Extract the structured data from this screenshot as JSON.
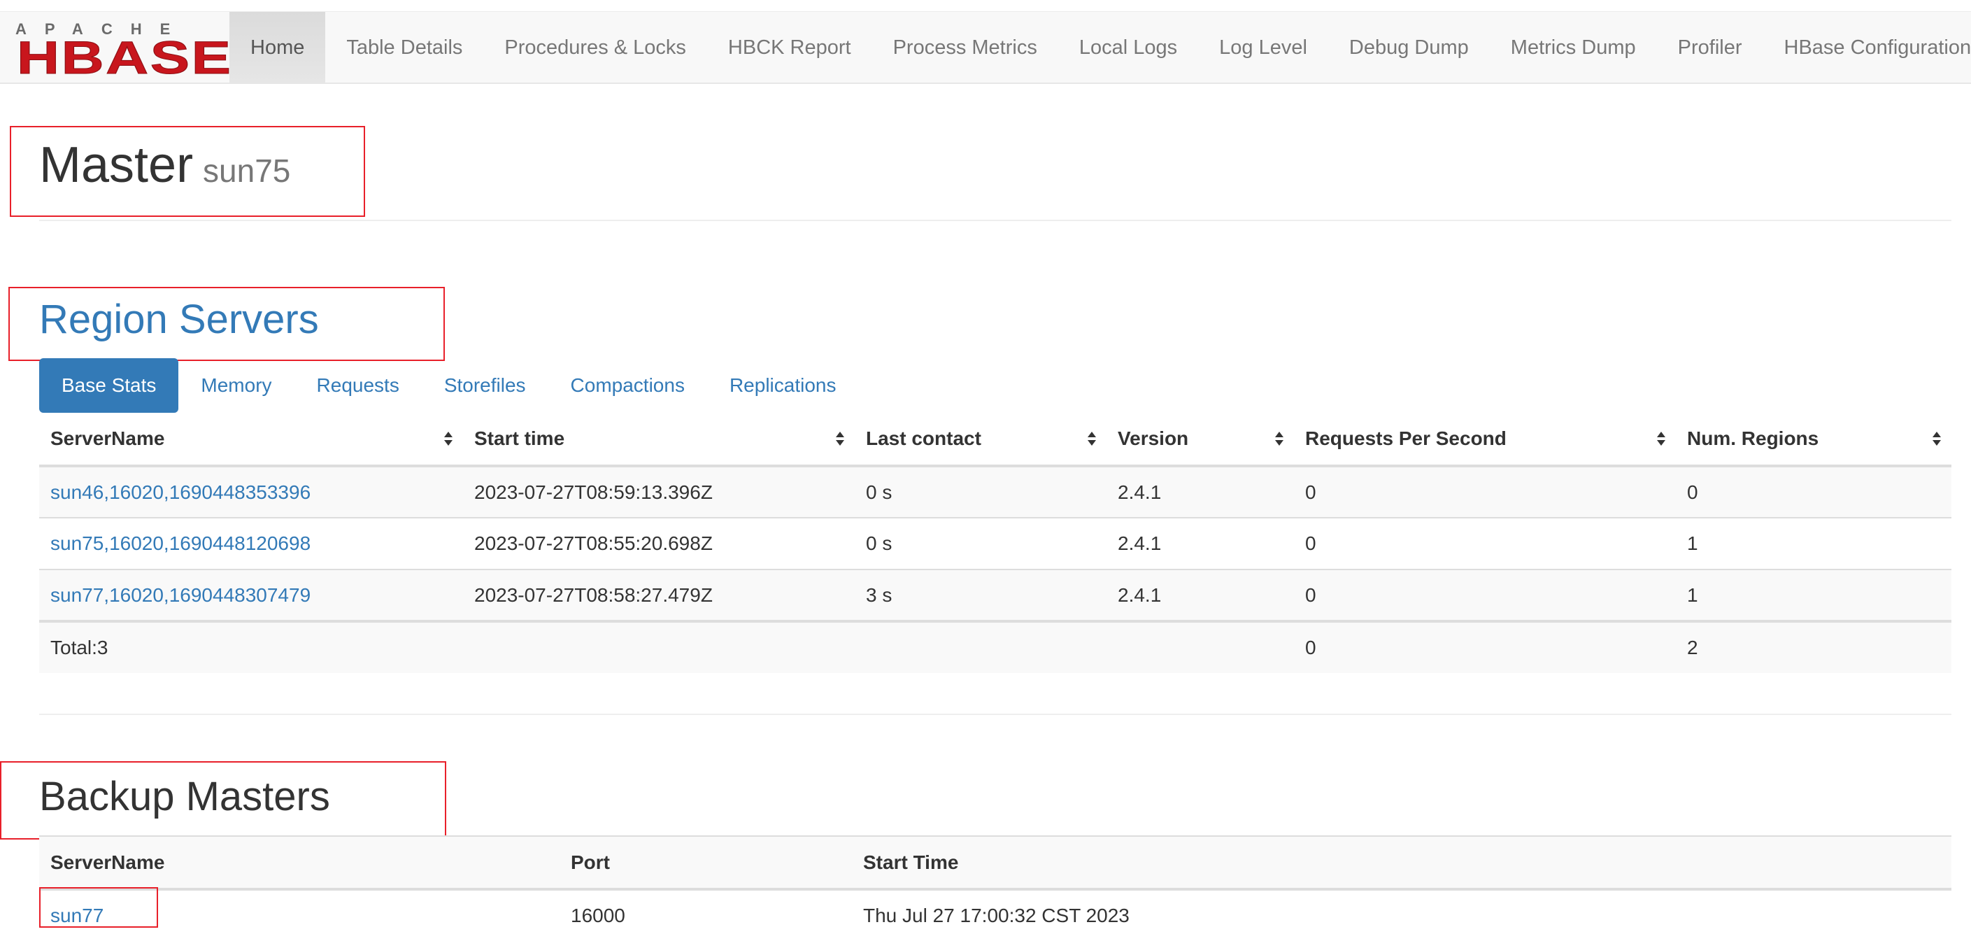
{
  "navbar": {
    "brand_top": "APACHE",
    "brand_main": "HBASE",
    "items": [
      {
        "label": "Home",
        "active": true
      },
      {
        "label": "Table Details"
      },
      {
        "label": "Procedures & Locks"
      },
      {
        "label": "HBCK Report"
      },
      {
        "label": "Process Metrics"
      },
      {
        "label": "Local Logs"
      },
      {
        "label": "Log Level"
      },
      {
        "label": "Debug Dump"
      },
      {
        "label": "Metrics Dump"
      },
      {
        "label": "Profiler"
      },
      {
        "label": "HBase Configuration"
      }
    ]
  },
  "header": {
    "title": "Master",
    "hostname": "sun75"
  },
  "region_servers": {
    "title": "Region Servers",
    "tabs": [
      {
        "label": "Base Stats",
        "active": true
      },
      {
        "label": "Memory"
      },
      {
        "label": "Requests"
      },
      {
        "label": "Storefiles"
      },
      {
        "label": "Compactions"
      },
      {
        "label": "Replications"
      }
    ],
    "columns": [
      "ServerName",
      "Start time",
      "Last contact",
      "Version",
      "Requests Per Second",
      "Num. Regions"
    ],
    "rows": [
      [
        "sun46,16020,1690448353396",
        "2023-07-27T08:59:13.396Z",
        "0 s",
        "2.4.1",
        "0",
        "0"
      ],
      [
        "sun75,16020,1690448120698",
        "2023-07-27T08:55:20.698Z",
        "0 s",
        "2.4.1",
        "0",
        "1"
      ],
      [
        "sun77,16020,1690448307479",
        "2023-07-27T08:58:27.479Z",
        "3 s",
        "2.4.1",
        "0",
        "1"
      ]
    ],
    "total": {
      "label": "Total:3",
      "requests_per_second": "0",
      "num_regions": "2"
    }
  },
  "backup_masters": {
    "title": "Backup Masters",
    "columns": [
      "ServerName",
      "Port",
      "Start Time"
    ],
    "rows": [
      [
        "sun77",
        "16000",
        "Thu Jul 27 17:00:32 CST 2023"
      ]
    ]
  },
  "colors": {
    "link": "#337ab7",
    "highlight_box": "#e8202a",
    "brand_red": "#c8161d"
  }
}
